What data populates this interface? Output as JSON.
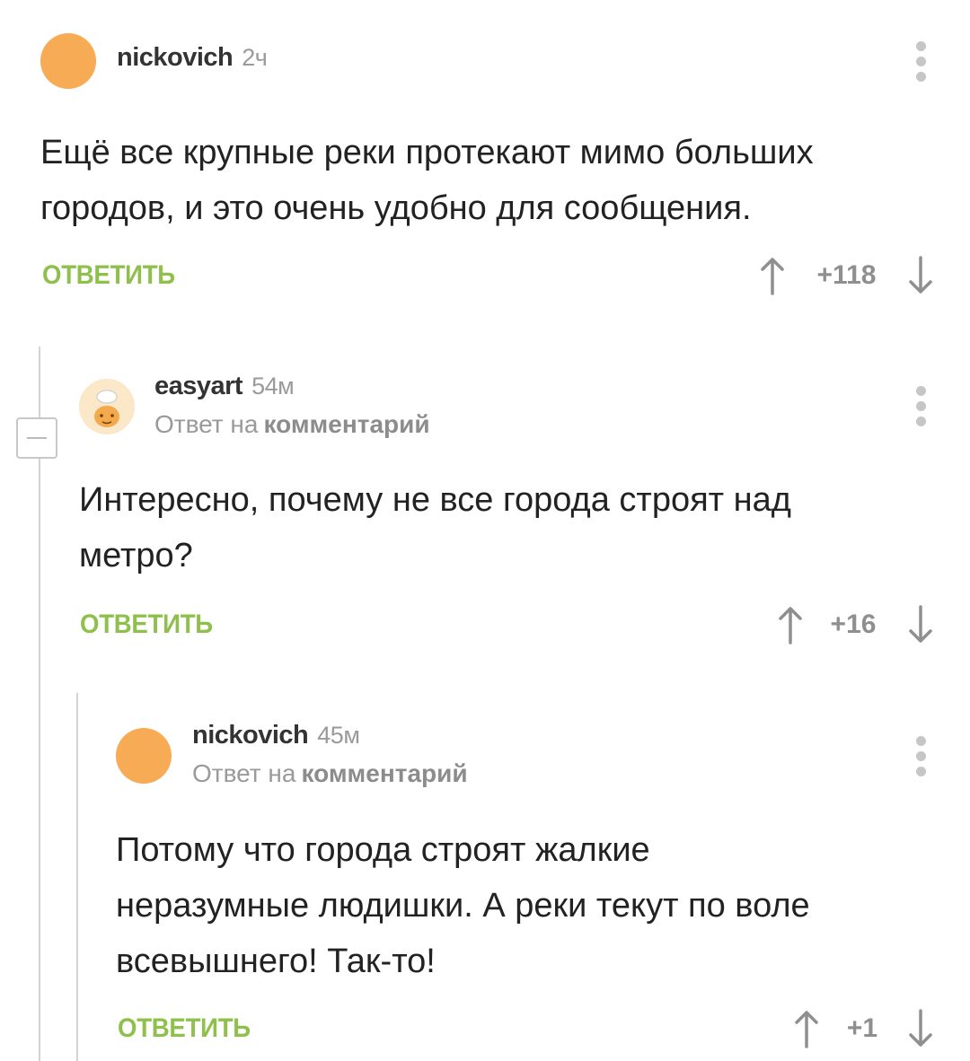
{
  "comments": [
    {
      "username": "nickovich",
      "time": "2ч",
      "text_lines": [
        "Ещё все крупные реки протекают мимо больших",
        "городов, и это очень удобно для сообщения."
      ],
      "reply_label": "ОТВЕТИТЬ",
      "rating": "+118"
    },
    {
      "username": "easyart",
      "time": "54м",
      "reply_prefix": "Ответ на",
      "reply_link": "комментарий",
      "text_lines": [
        "Интересно, почему не все города строят над",
        "метро?"
      ],
      "reply_label": "ОТВЕТИТЬ",
      "rating": "+16"
    },
    {
      "username": "nickovich",
      "time": "45м",
      "reply_prefix": "Ответ на",
      "reply_link": "комментарий",
      "text_lines": [
        "Потому что города строят жалкие",
        "неразумные людишки. А реки текут по воле",
        "всевышнего! Так-то!"
      ],
      "reply_label": "ОТВЕТИТЬ",
      "rating": "+1"
    }
  ],
  "colors": {
    "accent_green": "#8ec04b",
    "avatar_orange": "#f8ab55",
    "muted_gray": "#9a9a9a",
    "thread_line": "#d4d4d4"
  },
  "icons": [
    "avatar",
    "more-vertical-icon",
    "arrow-up-icon",
    "arrow-down-icon",
    "collapse-minus-icon"
  ]
}
